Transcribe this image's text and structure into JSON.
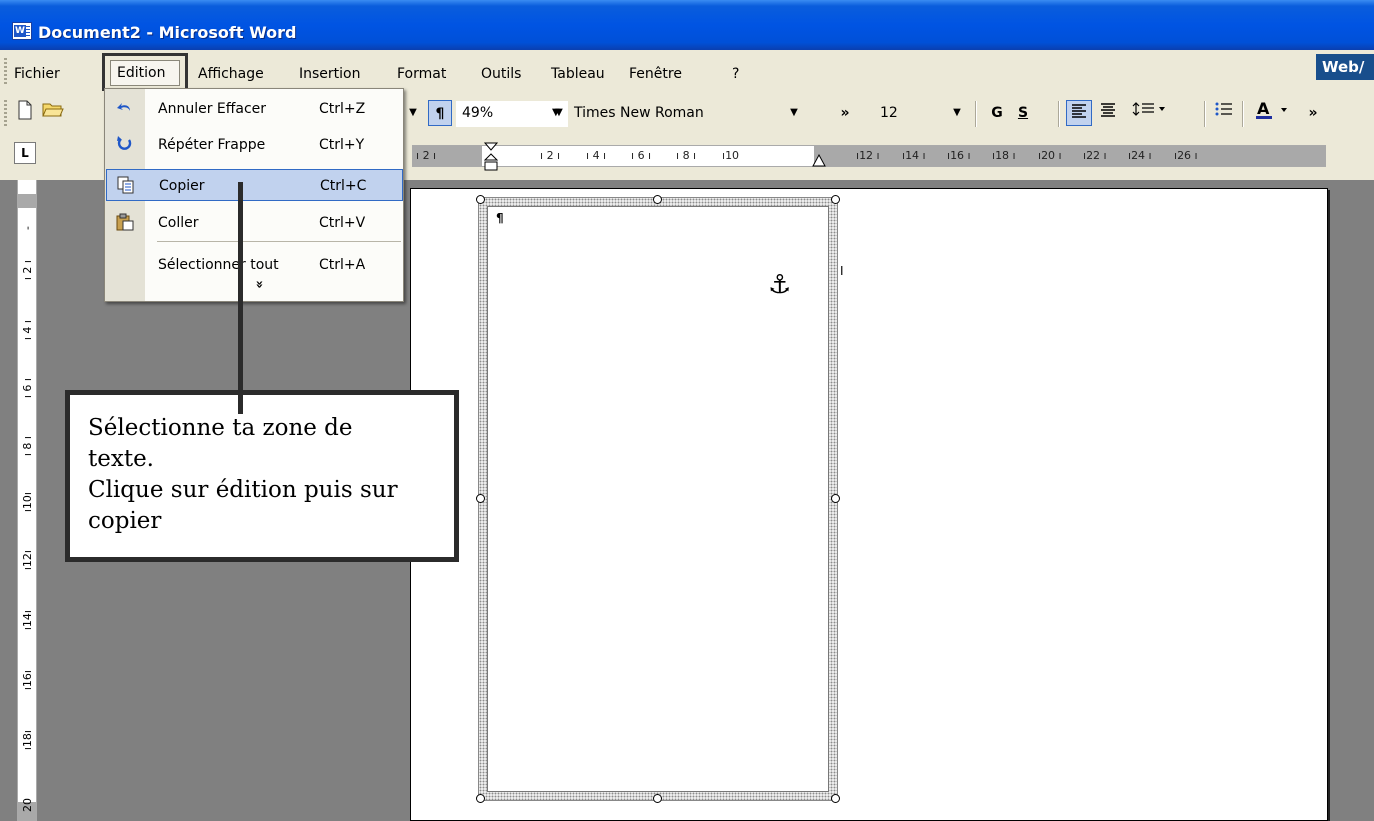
{
  "window": {
    "title": "Document2 - Microsoft Word",
    "web_tab": "Web/"
  },
  "menubar": {
    "items": [
      "Fichier",
      "Edition",
      "Affichage",
      "Insertion",
      "Format",
      "Outils",
      "Tableau",
      "Fenêtre",
      "?"
    ],
    "active": "Edition"
  },
  "toolbar": {
    "zoom": "49%",
    "font_name": "Times New Roman",
    "font_size": "12",
    "bold_label": "G",
    "strike_label": "S",
    "more_label": "»"
  },
  "ruler": {
    "horizontal_ticks": [
      "2",
      "2",
      "4",
      "6",
      "8",
      "10",
      "12",
      "14",
      "16",
      "18",
      "20",
      "22",
      "24",
      "26"
    ],
    "vertical_ticks": [
      "2",
      "4",
      "6",
      "8",
      "10",
      "12",
      "14",
      "16",
      "18",
      "20"
    ],
    "tab_selector": "L"
  },
  "edition_menu": {
    "items": [
      {
        "icon": "undo-icon",
        "label": "Annuler Effacer",
        "shortcut": "Ctrl+Z"
      },
      {
        "icon": "redo-icon",
        "label": "Répéter Frappe",
        "shortcut": "Ctrl+Y"
      },
      {
        "icon": "copy-icon",
        "label": "Copier",
        "shortcut": "Ctrl+C",
        "highlighted": true
      },
      {
        "icon": "paste-icon",
        "label": "Coller",
        "shortcut": "Ctrl+V"
      },
      {
        "icon": "",
        "label": "Sélectionner tout",
        "shortcut": "Ctrl+A"
      }
    ],
    "expand": "»"
  },
  "document": {
    "paragraph_mark": "¶",
    "anchor": "⚓"
  },
  "callout": {
    "lines": [
      "Sélectionne ta zone de",
      "texte.",
      "Clique sur édition puis sur",
      "copier"
    ]
  },
  "colors": {
    "title_bar": "#0054e3",
    "menu_highlight": "#c1d2ee",
    "menu_highlight_border": "#316ac5",
    "workspace": "#808080"
  }
}
